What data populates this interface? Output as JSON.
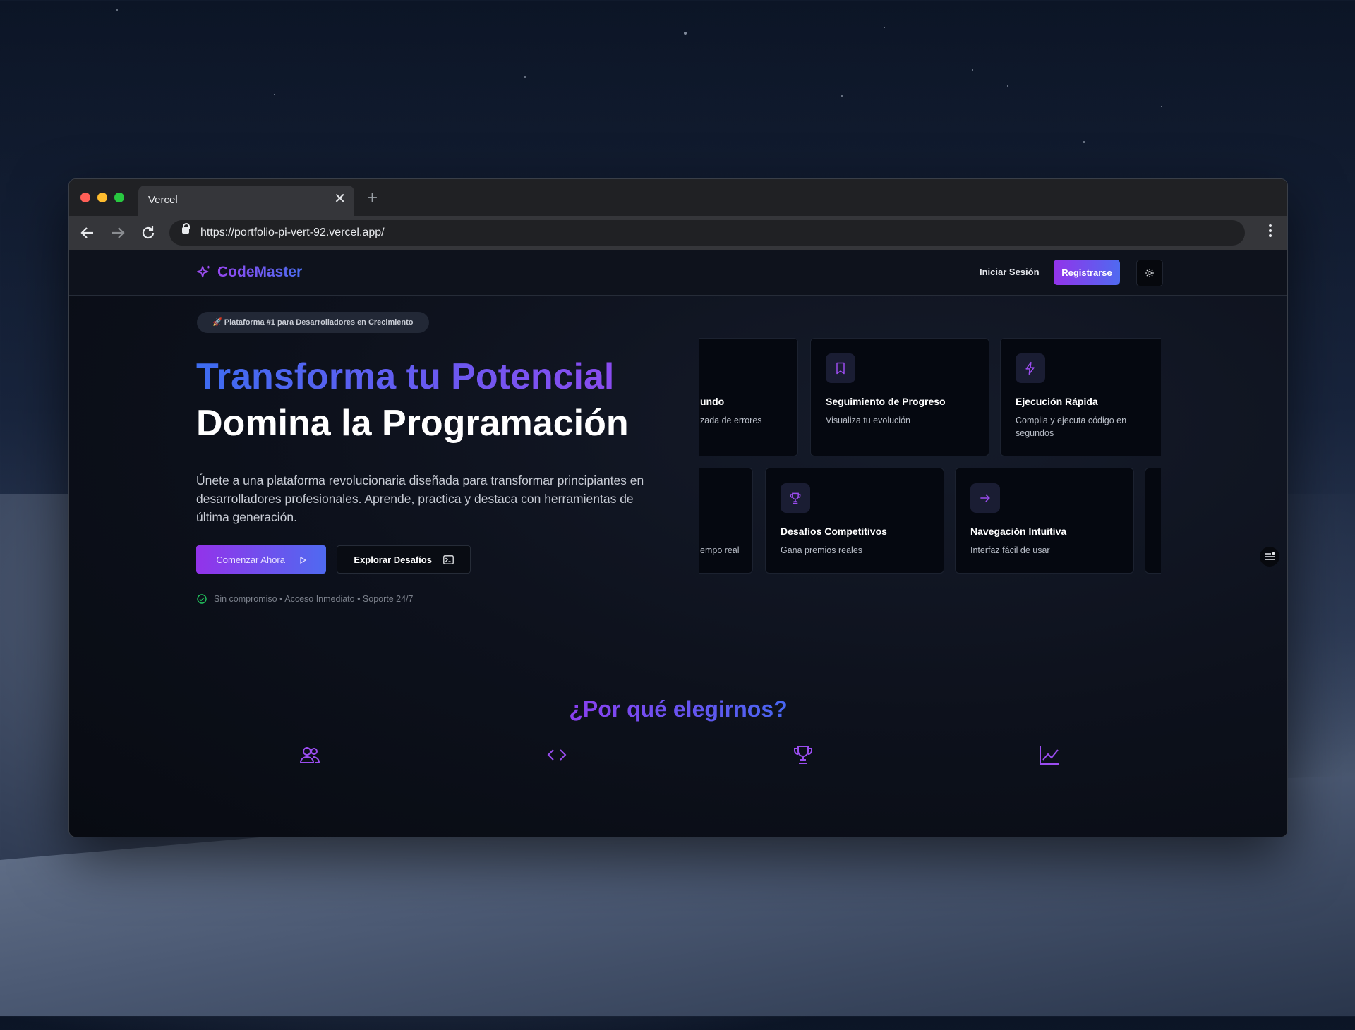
{
  "browser": {
    "tab_title": "Vercel",
    "tab_close": "✕",
    "new_tab": "+",
    "url": "https://portfolio-pi-vert-92.vercel.app/"
  },
  "site": {
    "brand": "CodeMaster",
    "nav": {
      "login": "Iniciar Sesión",
      "register": "Registrarse"
    },
    "hero": {
      "badge": "🚀 Plataforma #1 para Desarrolladores en Crecimiento",
      "title_line1": "Transforma tu Potencial",
      "title_line2": "Domina la Programación",
      "lead": "Únete a una plataforma revolucionaria diseñada para transformar principiantes en desarrolladores profesionales. Aprende, practica y destaca con herramientas de última generación.",
      "cta_primary": "Comenzar Ahora",
      "cta_secondary": "Explorar Desafíos",
      "note": "Sin compromiso • Acceso Inmediato • Soporte 24/7"
    },
    "feature_cards_row1": [
      {
        "title": "undo",
        "desc": "zada de errores",
        "icon": "partial-card"
      },
      {
        "title": "Seguimiento de Progreso",
        "desc": "Visualiza tu evolución",
        "icon": "bookmark-icon"
      },
      {
        "title": "Ejecución Rápida",
        "desc": "Compila y ejecuta código en segundos",
        "icon": "bolt-icon"
      }
    ],
    "feature_cards_row2": [
      {
        "title": "",
        "desc": "empo real",
        "icon": "partial-card"
      },
      {
        "title": "Desafíos Competitivos",
        "desc": "Gana premios reales",
        "icon": "trophy-icon"
      },
      {
        "title": "Navegación Intuitiva",
        "desc": "Interfaz fácil de usar",
        "icon": "arrow-right-icon"
      }
    ],
    "why_title": "¿Por qué elegirnos?",
    "why_icons": [
      "users-icon",
      "code-icon",
      "trophy-icon",
      "chart-line-icon"
    ]
  },
  "colors": {
    "accent_purple": "#9333ea",
    "accent_blue": "#4f6af0",
    "icon_purple": "#9b4df0"
  }
}
